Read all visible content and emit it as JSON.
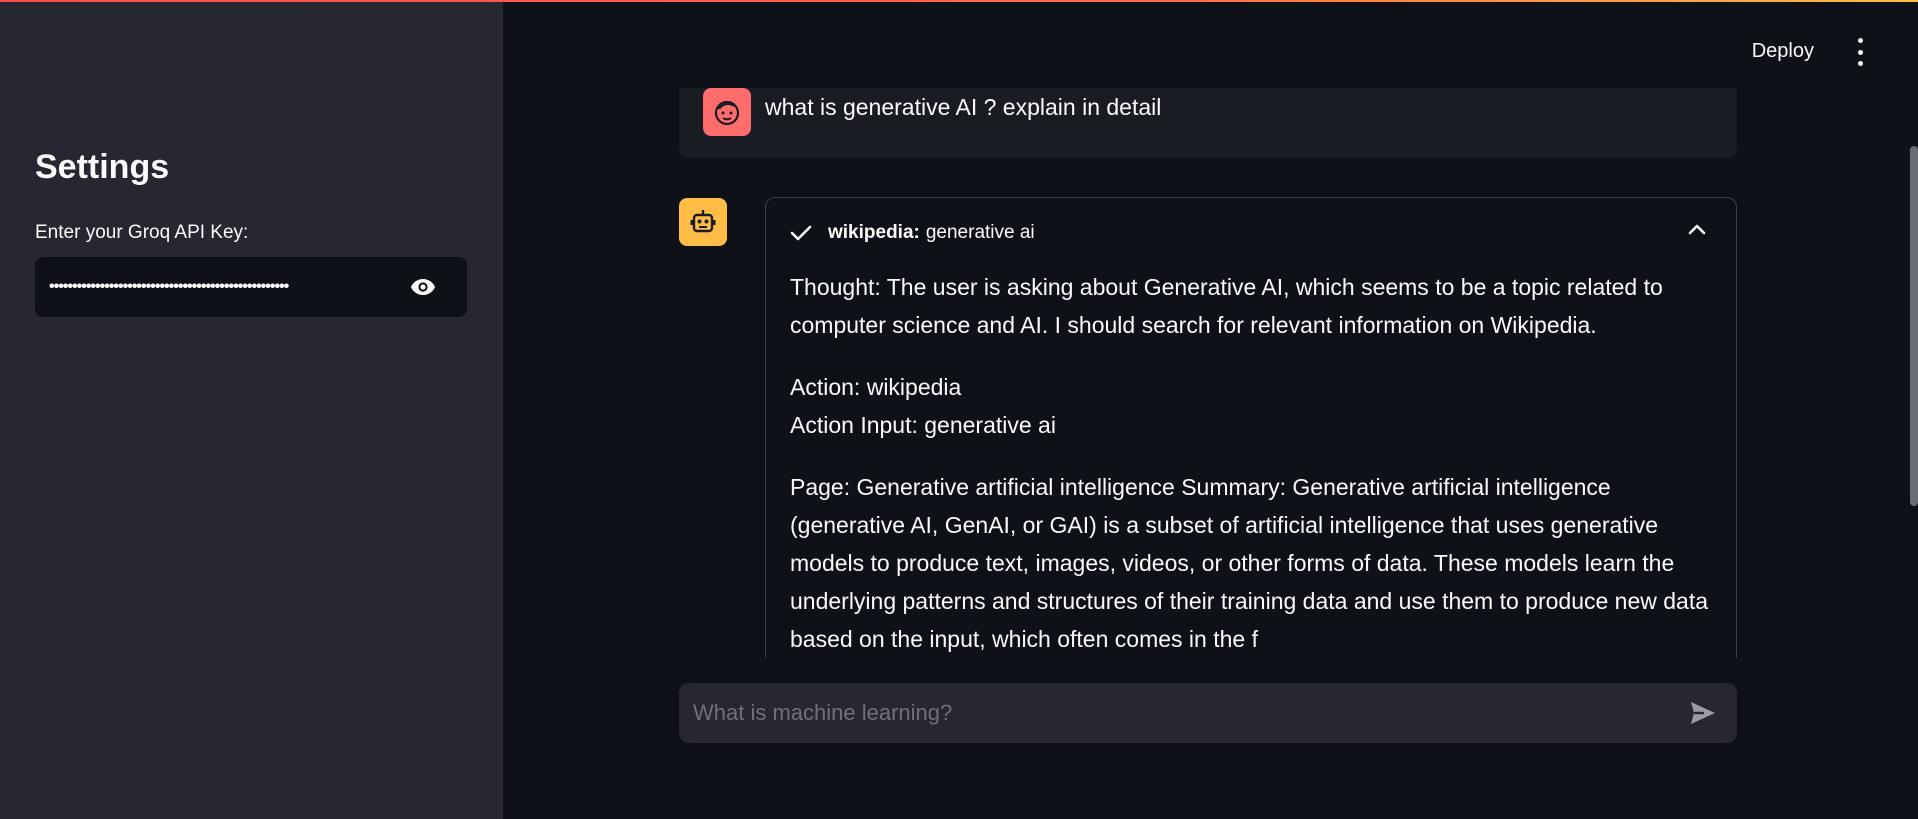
{
  "sidebar": {
    "title": "Settings",
    "api_key_label": "Enter your Groq API Key:",
    "api_key_value": "••••••••••••••••••••••••••••••••••••••••••••••••••••"
  },
  "header": {
    "deploy_label": "Deploy"
  },
  "chat": {
    "user_message": "what is generative AI ? explain in detail",
    "tool": {
      "name": "wikipedia:",
      "query": "generative ai",
      "paragraphs": [
        "Thought: The user is asking about Generative AI, which seems to be a topic related to computer science and AI. I should search for relevant information on Wikipedia.",
        "Action: wikipedia",
        "Action Input: generative ai",
        "Page: Generative artificial intelligence Summary: Generative artificial intelligence (generative AI, GenAI, or GAI) is a subset of artificial intelligence that uses generative models to produce text, images, videos, or other forms of data. These models learn the underlying patterns and structures of their training data and use them to produce new data based on the input, which often comes in the f"
      ]
    },
    "input_placeholder": "What is machine learning?"
  },
  "colors": {
    "accent": "#ff4b4b",
    "user_avatar": "#ff6c6c",
    "bot_avatar": "#ffbd45"
  },
  "icons": [
    "eye-icon",
    "more-vert-icon",
    "user-face-icon",
    "robot-icon",
    "check-icon",
    "chevron-up-icon",
    "send-icon"
  ]
}
